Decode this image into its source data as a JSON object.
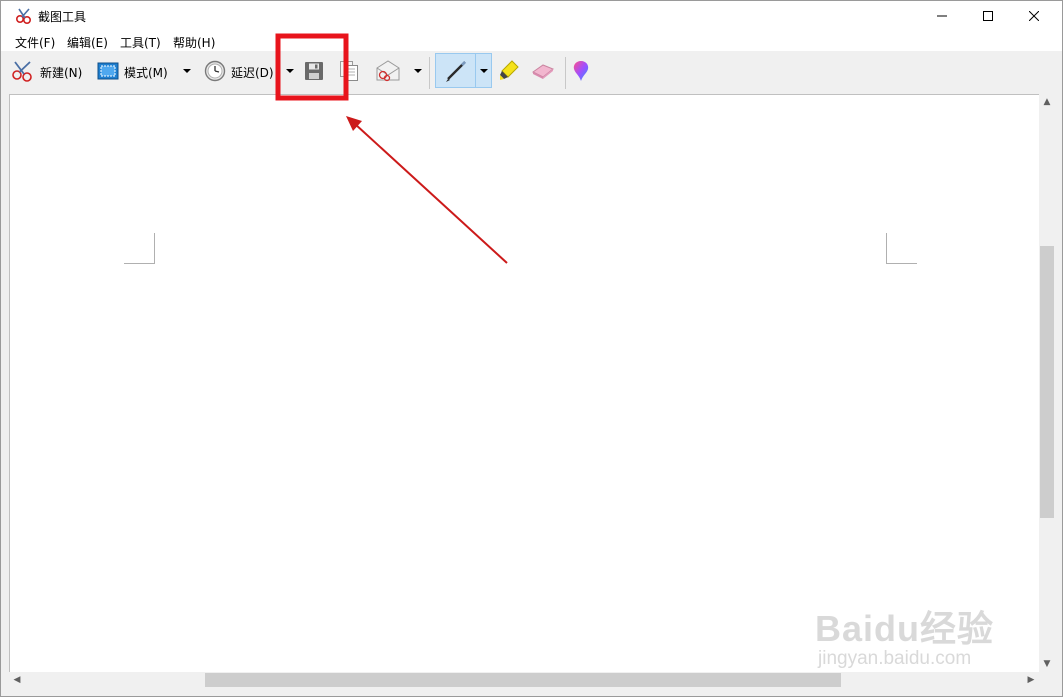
{
  "window": {
    "title": "截图工具",
    "controls": {
      "minimize": "minimize-icon",
      "maximize": "maximize-icon",
      "close": "close-icon"
    }
  },
  "menu": [
    "文件(F)",
    "编辑(E)",
    "工具(T)",
    "帮助(H)"
  ],
  "toolbar": {
    "new_label": "新建(N)",
    "mode_label": "模式(M)",
    "delay_label": "延迟(D)",
    "icons": [
      "snip-scissors-icon",
      "mode-rectangle-icon",
      "clock-icon",
      "save-icon",
      "copy-icon",
      "send-email-icon",
      "pen-icon",
      "highlighter-icon",
      "eraser-icon",
      "paint3d-icon"
    ]
  },
  "colors": {
    "annotation_red": "#e8141c",
    "pen_group_bg": "#cce4f7"
  },
  "watermark": {
    "logo": "Baidu经验",
    "url": "jingyan.baidu.com"
  }
}
